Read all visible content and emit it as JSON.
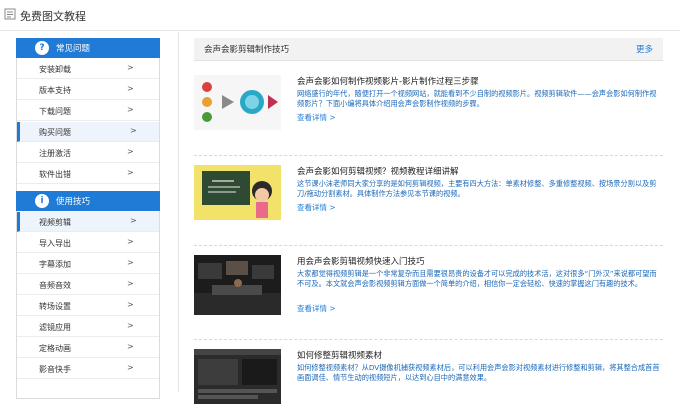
{
  "header": {
    "title": "免费图文教程"
  },
  "sidebar": {
    "sections": [
      {
        "title": "常见问题",
        "icon": "question-icon",
        "items": [
          {
            "label": "安装卸载",
            "arrow": ">"
          },
          {
            "label": "版本支持",
            "arrow": ">"
          },
          {
            "label": "下载问题",
            "arrow": ">"
          },
          {
            "label": "购买问题",
            "arrow": ">"
          },
          {
            "label": "注册激活",
            "arrow": ">"
          },
          {
            "label": "软件出错",
            "arrow": ">"
          }
        ]
      },
      {
        "title": "使用技巧",
        "icon": "info-icon",
        "items": [
          {
            "label": "视频剪辑",
            "arrow": ">"
          },
          {
            "label": "导入导出",
            "arrow": ">"
          },
          {
            "label": "字幕添加",
            "arrow": ">"
          },
          {
            "label": "音频音效",
            "arrow": ">"
          },
          {
            "label": "转场设置",
            "arrow": ">"
          },
          {
            "label": "滤镜应用",
            "arrow": ">"
          },
          {
            "label": "定格动画",
            "arrow": ">"
          },
          {
            "label": "影音快手",
            "arrow": ">"
          }
        ]
      }
    ]
  },
  "panel": {
    "title": "会声会影剪辑制作技巧",
    "more": "更多",
    "articles": [
      {
        "title": "会声会影如何制作视频影片-影片制作过程三步骤",
        "desc": "网络盛行的年代，随便打开一个视频网站，就能看到不少自制的视频影片。视频剪辑软件——会声会影如何制作视频影片？下面小编将具体介绍用会声会影制作视频的步骤。",
        "read": "查看详情 >"
      },
      {
        "title": "会声会影如何剪辑视频？视频教程详细讲解",
        "desc": "这节课小沫老师同大家分享的是如何剪辑视频，主要有四大方法：单素材修整、多重修整视频、按场景分割以及剪刀/拖动分割素材。具体制作方法参见本节课的视频。",
        "read": "查看详情 >"
      },
      {
        "title": "用会声会影剪辑视频快速入门技巧",
        "desc": "大家都觉得视频剪辑是一个非常复杂而且需要很昂贵的设备才可以完成的技术活，这对很多“门外汉”来说都可望而不可及。本文就会声会影视频剪辑方面做一个简单的介绍，相信你一定会轻松、快速的掌握这门有趣的技术。",
        "read": "查看详情 >"
      },
      {
        "title": "如何修整剪辑视频素材",
        "desc": "如何修整视频素材？从DV摄像机捕获视频素材后，可以利用会声会影对视频素材进行修整和剪辑，将其整合成首首画面调佳、情节生动的视频短片，以达到心目中的满意效果。",
        "read": ""
      }
    ]
  },
  "colors": {
    "accent": "#1f7bd6",
    "link": "#1a67b8"
  }
}
